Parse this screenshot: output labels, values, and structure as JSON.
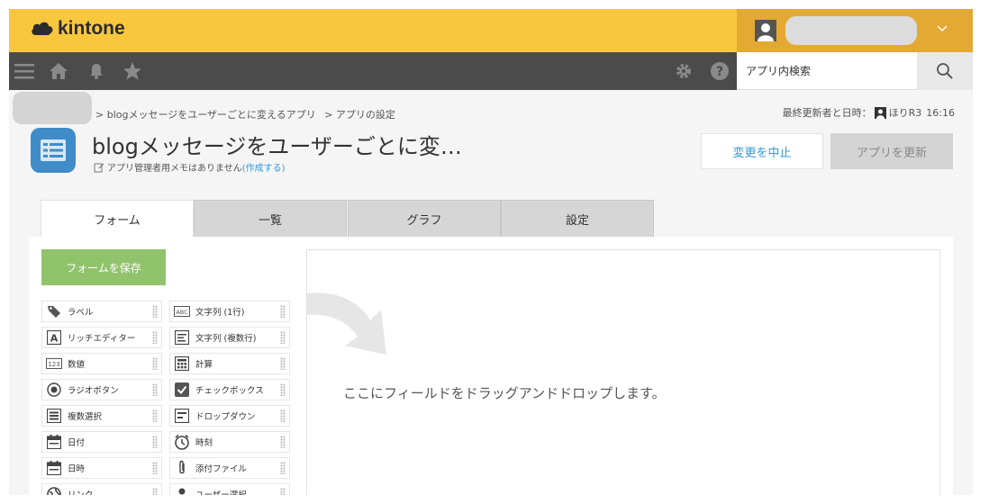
{
  "header": {
    "logo": "kintone",
    "search_placeholder": "アプリ内検索"
  },
  "breadcrumb": {
    "items": [
      "> blogメッセージをユーザーごとに変えるアプリ",
      "> アプリの設定"
    ]
  },
  "last_update": {
    "label": "最終更新者と日時：",
    "user": "ほりR3",
    "time": "16:16"
  },
  "app": {
    "title": "blogメッセージをユーザーごとに変…",
    "memo": "アプリ管理者用メモはありません",
    "memo_link": "(作成する)"
  },
  "actions": {
    "cancel": "変更を中止",
    "update": "アプリを更新"
  },
  "tabs": [
    "フォーム",
    "一覧",
    "グラフ",
    "設定"
  ],
  "form": {
    "save_button": "フォームを保存",
    "drop_hint": "ここにフィールドをドラッグアンドドロップします。"
  },
  "palette": [
    {
      "label": "ラベル",
      "icon": "tag-icon"
    },
    {
      "label": "文字列 (1行)",
      "icon": "abc-icon"
    },
    {
      "label": "リッチエディター",
      "icon": "rich-editor-icon"
    },
    {
      "label": "文字列 (複数行)",
      "icon": "multiline-icon"
    },
    {
      "label": "数値",
      "icon": "number-icon"
    },
    {
      "label": "計算",
      "icon": "calculator-icon"
    },
    {
      "label": "ラジオボタン",
      "icon": "radio-icon"
    },
    {
      "label": "チェックボックス",
      "icon": "checkbox-icon"
    },
    {
      "label": "複数選択",
      "icon": "multi-select-icon"
    },
    {
      "label": "ドロップダウン",
      "icon": "dropdown-icon"
    },
    {
      "label": "日付",
      "icon": "date-icon"
    },
    {
      "label": "時刻",
      "icon": "clock-icon"
    },
    {
      "label": "日時",
      "icon": "datetime-icon"
    },
    {
      "label": "添付ファイル",
      "icon": "paperclip-icon"
    },
    {
      "label": "リンク",
      "icon": "globe-icon"
    },
    {
      "label": "ユーザー選択",
      "icon": "user-icon"
    }
  ]
}
